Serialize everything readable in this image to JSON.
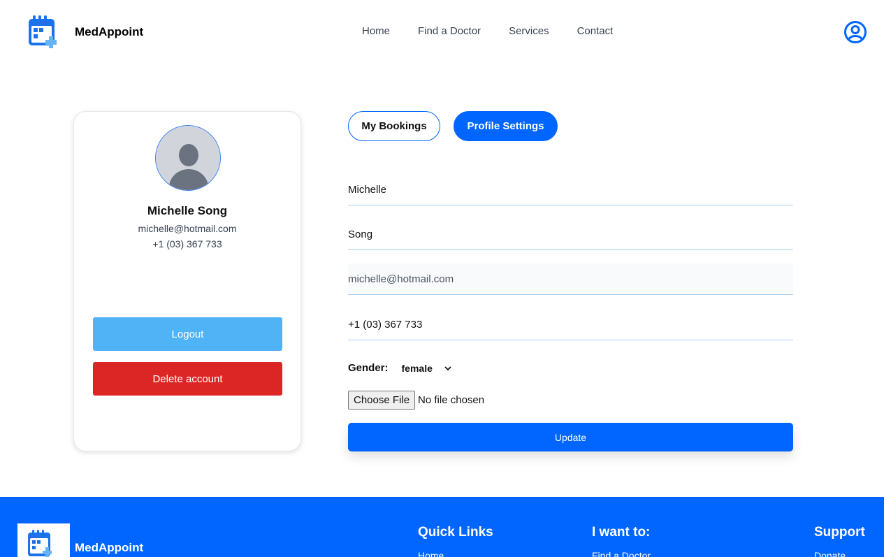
{
  "header": {
    "brand": "MedAppoint",
    "logo_icon": "calendar-plus-icon",
    "nav": [
      "Home",
      "Find a Doctor",
      "Services",
      "Contact"
    ],
    "user_icon": "user-circle-icon"
  },
  "profile_card": {
    "avatar_icon": "default-avatar-icon",
    "name": "Michelle Song",
    "email": "michelle@hotmail.com",
    "phone": "+1 (03) 367 733",
    "logout_label": "Logout",
    "delete_label": "Delete account"
  },
  "tabs": {
    "bookings": "My Bookings",
    "settings": "Profile Settings",
    "active": "Profile Settings"
  },
  "form": {
    "first_name": "Michelle",
    "last_name": "Song",
    "email": "michelle@hotmail.com",
    "phone": "+1 (03) 367 733",
    "gender_label": "Gender:",
    "gender_value": "female",
    "file_button": "Choose File",
    "file_status": "No file chosen",
    "update_label": "Update"
  },
  "footer": {
    "brand": "MedAppoint",
    "columns": [
      {
        "title": "Quick Links",
        "first_link": "Home"
      },
      {
        "title": "I want to:",
        "first_link": "Find a Doctor"
      },
      {
        "title": "Support",
        "first_link": "Donate"
      }
    ]
  },
  "colors": {
    "primary": "#0066ff",
    "logout": "#4fb3f6",
    "danger": "#dc2626",
    "input_border": "#a8cdf0"
  }
}
